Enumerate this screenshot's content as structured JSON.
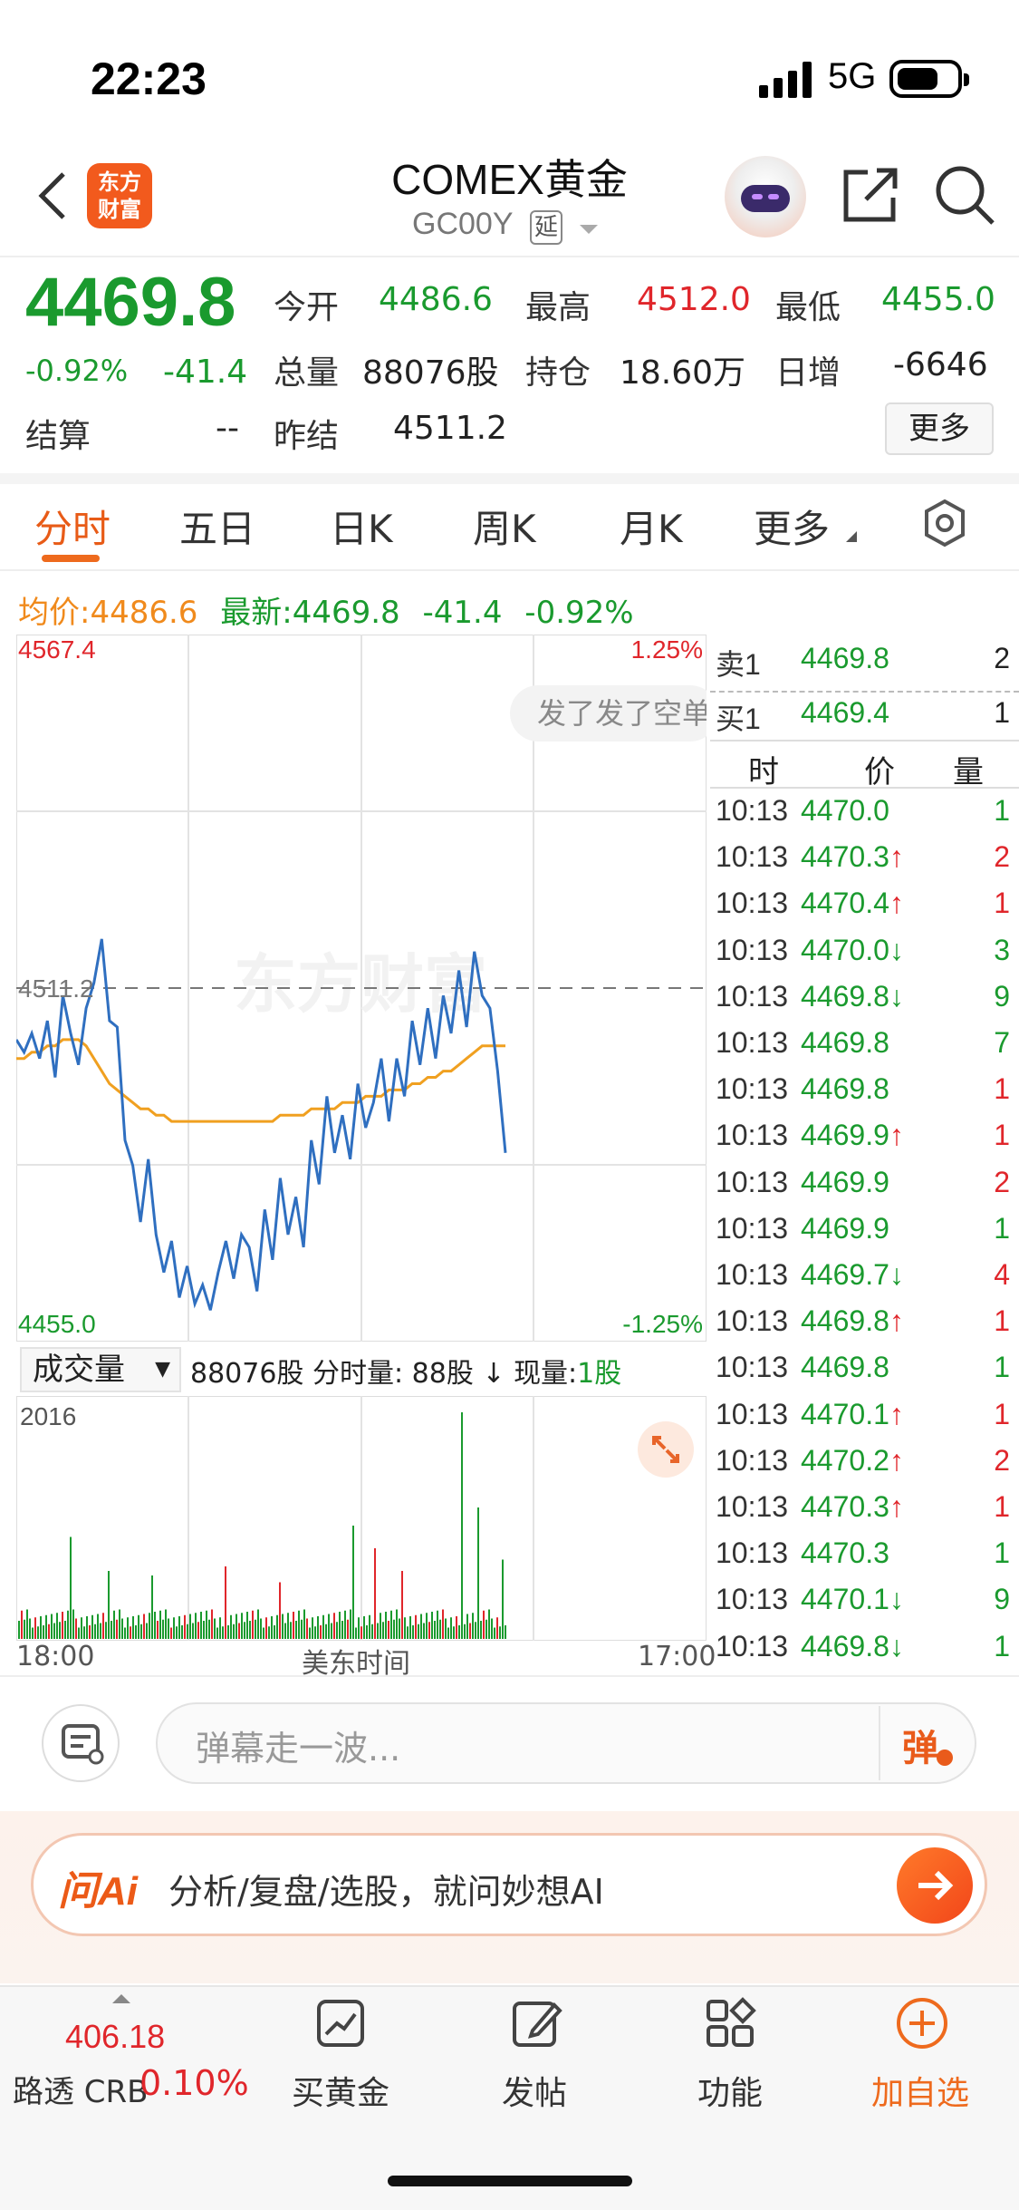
{
  "status_bar": {
    "time": "22:23",
    "network": "5G"
  },
  "header": {
    "app_logo_text": "东方财富",
    "title": "COMEX黄金",
    "code": "GC00Y",
    "delay_badge": "延",
    "icons": [
      "back-arrow-icon",
      "robot-assistant-icon",
      "share-icon",
      "search-icon"
    ]
  },
  "quote": {
    "price": "4469.8",
    "change_pct": "-0.92%",
    "change": "-41.4",
    "labels": {
      "open": "今开",
      "high": "最高",
      "low": "最低",
      "volume": "总量",
      "position": "持仓",
      "daily_inc": "日增",
      "settle": "结算",
      "prev_settle": "昨结"
    },
    "values": {
      "open": "4486.6",
      "high": "4512.0",
      "low": "4455.0",
      "volume": "88076股",
      "position": "18.60万",
      "daily_inc": "-6646",
      "settle": "--",
      "prev_settle": "4511.2"
    },
    "more_label": "更多"
  },
  "tabs": [
    "分时",
    "五日",
    "日K",
    "周K",
    "月K",
    "更多"
  ],
  "chart_header": {
    "avg_label": "均价:",
    "avg_value": "4486.6",
    "latest_label": "最新:",
    "latest_value": "4469.8",
    "latest_change": "-41.4",
    "latest_pct": "-0.92%"
  },
  "chart_data": {
    "type": "line",
    "y_max_label": "4567.4",
    "y_min_label": "4455.0",
    "ref_label": "4511.2",
    "pct_top": "1.25%",
    "pct_bottom": "-1.25%",
    "watermark": "东方财富",
    "danmaku": "发了发了空单",
    "ylim": [
      4455.0,
      4567.4
    ],
    "ref_value": 4511.2,
    "price_series": [
      4503,
      4501,
      4504,
      4500,
      4506,
      4497,
      4510,
      4504,
      4499,
      4508,
      4512,
      4519,
      4506,
      4505,
      4487,
      4483,
      4474,
      4484,
      4472,
      4466,
      4471,
      4462,
      4467,
      4461,
      4464,
      4460,
      4466,
      4471,
      4465,
      4472,
      4470,
      4463,
      4476,
      4468,
      4481,
      4472,
      4478,
      4470,
      4487,
      4480,
      4494,
      4485,
      4491,
      4484,
      4496,
      4489,
      4493,
      4500,
      4490,
      4500,
      4494,
      4506,
      4499,
      4508,
      4500,
      4510,
      4504,
      4514,
      4505,
      4517,
      4510,
      4508,
      4498,
      4485
    ],
    "avg_series": [
      4500,
      4500,
      4501,
      4501,
      4502,
      4502,
      4503,
      4503,
      4503,
      4502,
      4500,
      4498,
      4496,
      4495,
      4494,
      4493,
      4492,
      4492,
      4491,
      4491,
      4490,
      4490,
      4490,
      4490,
      4490,
      4490,
      4490,
      4490,
      4490,
      4490,
      4490,
      4490,
      4490,
      4490,
      4491,
      4491,
      4491,
      4491,
      4492,
      4492,
      4492,
      4492,
      4493,
      4493,
      4493,
      4494,
      4494,
      4494,
      4495,
      4495,
      4495,
      4496,
      4496,
      4497,
      4497,
      4498,
      4498,
      4499,
      4500,
      4501,
      4502,
      4502,
      4502,
      4502
    ],
    "x_start": "18:00",
    "x_mid": "美东时间",
    "x_end": "17:00"
  },
  "volume": {
    "selector": "成交量",
    "total": "88076股",
    "interval_label": "分时量:",
    "interval_value": "88股",
    "arrow": "↓",
    "now_label": "现量:",
    "now_value": "1股",
    "max_label": "2016"
  },
  "order_book": {
    "ask": {
      "label": "卖1",
      "price": "4469.8",
      "vol": "2"
    },
    "bid": {
      "label": "买1",
      "price": "4469.4",
      "vol": "1"
    },
    "headers": [
      "时",
      "价",
      "量"
    ],
    "ticks": [
      {
        "t": "10:13",
        "p": "4470.0",
        "d": "",
        "v": "1",
        "c": "green"
      },
      {
        "t": "10:13",
        "p": "4470.3",
        "d": "↑",
        "v": "2",
        "c": "red"
      },
      {
        "t": "10:13",
        "p": "4470.4",
        "d": "↑",
        "v": "1",
        "c": "red"
      },
      {
        "t": "10:13",
        "p": "4470.0",
        "d": "↓",
        "v": "3",
        "c": "green"
      },
      {
        "t": "10:13",
        "p": "4469.8",
        "d": "↓",
        "v": "9",
        "c": "green"
      },
      {
        "t": "10:13",
        "p": "4469.8",
        "d": "",
        "v": "7",
        "c": "green"
      },
      {
        "t": "10:13",
        "p": "4469.8",
        "d": "",
        "v": "1",
        "c": "red"
      },
      {
        "t": "10:13",
        "p": "4469.9",
        "d": "↑",
        "v": "1",
        "c": "red"
      },
      {
        "t": "10:13",
        "p": "4469.9",
        "d": "",
        "v": "2",
        "c": "red"
      },
      {
        "t": "10:13",
        "p": "4469.9",
        "d": "",
        "v": "1",
        "c": "green"
      },
      {
        "t": "10:13",
        "p": "4469.7",
        "d": "↓",
        "v": "4",
        "c": "red"
      },
      {
        "t": "10:13",
        "p": "4469.8",
        "d": "↑",
        "v": "1",
        "c": "red"
      },
      {
        "t": "10:13",
        "p": "4469.8",
        "d": "",
        "v": "1",
        "c": "green"
      },
      {
        "t": "10:13",
        "p": "4470.1",
        "d": "↑",
        "v": "1",
        "c": "red"
      },
      {
        "t": "10:13",
        "p": "4470.2",
        "d": "↑",
        "v": "2",
        "c": "red"
      },
      {
        "t": "10:13",
        "p": "4470.3",
        "d": "↑",
        "v": "1",
        "c": "red"
      },
      {
        "t": "10:13",
        "p": "4470.3",
        "d": "",
        "v": "1",
        "c": "green"
      },
      {
        "t": "10:13",
        "p": "4470.1",
        "d": "↓",
        "v": "9",
        "c": "green"
      },
      {
        "t": "10:13",
        "p": "4469.8",
        "d": "↓",
        "v": "1",
        "c": "green"
      }
    ]
  },
  "comment": {
    "placeholder": "弹幕走一波...",
    "send_label": "弹"
  },
  "ai": {
    "logo": "问Ai",
    "text": "分析/复盘/选股，就问妙想AI"
  },
  "bottom_nav": {
    "index_value": "406.18",
    "index_name": "路透 CRB",
    "index_pct": "0.10%",
    "items": [
      {
        "label": "买黄金",
        "icon": "chart-buy-icon"
      },
      {
        "label": "发帖",
        "icon": "edit-post-icon"
      },
      {
        "label": "功能",
        "icon": "grid-apps-icon"
      },
      {
        "label": "加自选",
        "icon": "plus-circle-icon"
      }
    ]
  },
  "colors": {
    "up": "#e0262b",
    "down": "#1a9a2e",
    "accent": "#f25a1d",
    "price_line": "#2f6fc0",
    "avg_line": "#f0a020"
  }
}
